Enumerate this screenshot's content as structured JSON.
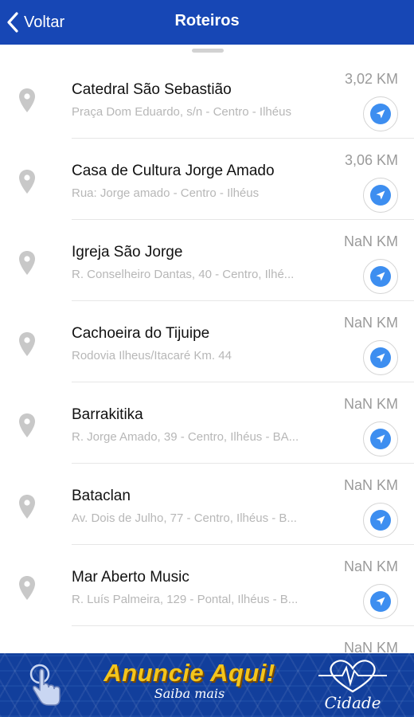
{
  "header": {
    "back_label": "Voltar",
    "title": "Roteiros",
    "background_color": "#1747b5"
  },
  "places": [
    {
      "name": "Catedral São Sebastião",
      "address": "Praça Dom Eduardo, s/n - Centro - Ilhéus",
      "distance": "3,02 KM"
    },
    {
      "name": "Casa de Cultura Jorge Amado",
      "address": "Rua: Jorge amado - Centro - Ilhéus",
      "distance": "3,06 KM"
    },
    {
      "name": "Igreja São Jorge",
      "address": "R. Conselheiro Dantas, 40 - Centro, Ilhé...",
      "distance": "NaN KM"
    },
    {
      "name": "Cachoeira do Tijuipe",
      "address": "Rodovia Ilheus/Itacaré Km. 44",
      "distance": "NaN KM"
    },
    {
      "name": "Barrakitika",
      "address": "R. Jorge Amado, 39 - Centro, Ilhéus - BA...",
      "distance": "NaN KM"
    },
    {
      "name": "Bataclan",
      "address": "Av. Dois de Julho, 77 - Centro, Ilhéus - B...",
      "distance": "NaN KM"
    },
    {
      "name": "Mar Aberto Music",
      "address": "R. Luís Palmeira, 129 - Pontal, Ilhéus - B...",
      "distance": "NaN KM"
    },
    {
      "name": "",
      "address": "",
      "distance": "NaN KM"
    }
  ],
  "icons": {
    "back": "chevron-left-icon",
    "place": "map-pin-icon",
    "navigate": "navigation-arrow-icon",
    "banner_hand": "tap-hand-icon",
    "banner_logo": "heart-pulse-icon"
  },
  "colors": {
    "accent": "#3d8ef0",
    "banner_background": "#123f9c",
    "banner_text": "#f4c51c"
  },
  "banner": {
    "ad_title": "Anuncie Aqui!",
    "ad_subtitle": "Saiba mais",
    "logo_text": "Cidade"
  }
}
